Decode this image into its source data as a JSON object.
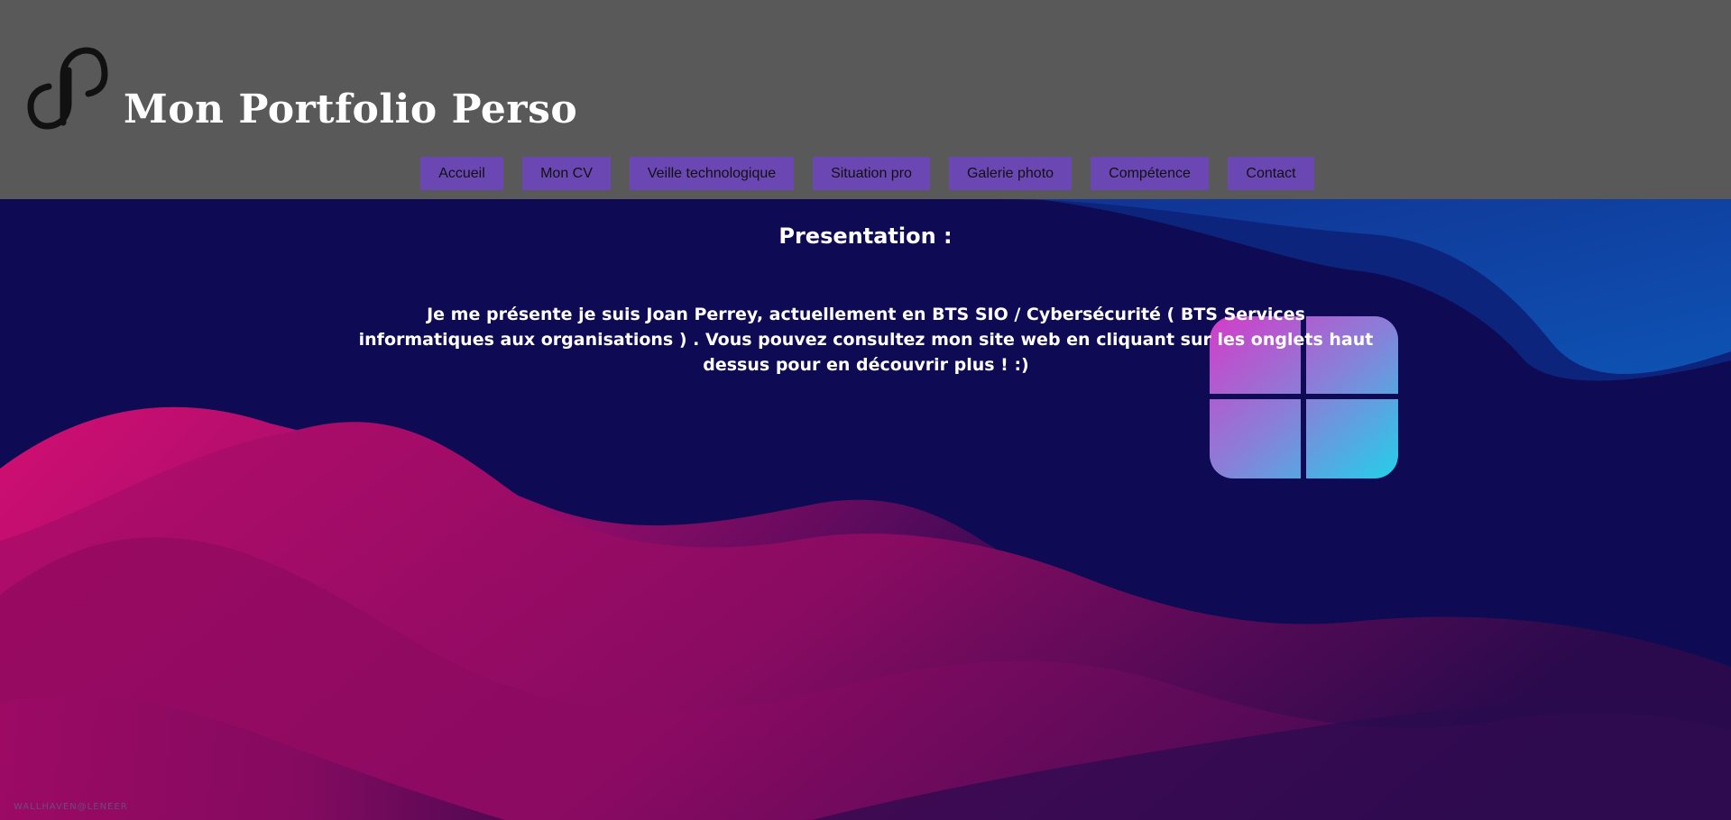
{
  "header": {
    "site_title": "Mon Portfolio Perso",
    "logo_icon": "paperclip-p-logo-icon",
    "background_color": "#595959"
  },
  "nav": {
    "item_color": "#6b47b3",
    "items": [
      {
        "label": "Accueil"
      },
      {
        "label": "Mon CV"
      },
      {
        "label": "Veille technologique"
      },
      {
        "label": "Situation pro"
      },
      {
        "label": "Galerie photo"
      },
      {
        "label": "Compétence"
      },
      {
        "label": "Contact"
      }
    ]
  },
  "main": {
    "title": "Presentation :",
    "intro": "Je me présente je suis Joan Perrey, actuellement en BTS SIO / Cybersécurité ( BTS Services informatiques aux organisations ) . Vous pouvez consultez mon site web en cliquant sur les onglets haut dessus pour en découvrir plus ! :)",
    "decoration_icon": "windows-logo-icon"
  },
  "background": {
    "base_color": "#0f0a54",
    "wave_colors": [
      "#c70f6e",
      "#8f0b61",
      "#1565c0"
    ],
    "watermark": "WALLHAVEN@LENEER"
  }
}
